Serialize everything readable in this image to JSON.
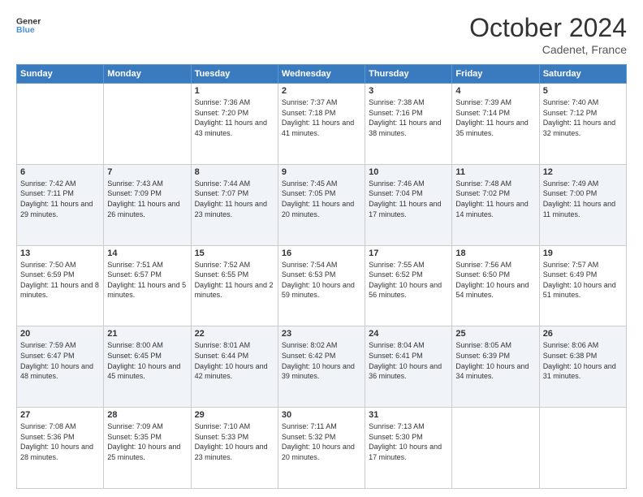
{
  "header": {
    "logo_line1": "General",
    "logo_line2": "Blue",
    "month": "October 2024",
    "location": "Cadenet, France"
  },
  "weekdays": [
    "Sunday",
    "Monday",
    "Tuesday",
    "Wednesday",
    "Thursday",
    "Friday",
    "Saturday"
  ],
  "weeks": [
    [
      {
        "day": "",
        "sunrise": "",
        "sunset": "",
        "daylight": ""
      },
      {
        "day": "",
        "sunrise": "",
        "sunset": "",
        "daylight": ""
      },
      {
        "day": "1",
        "sunrise": "Sunrise: 7:36 AM",
        "sunset": "Sunset: 7:20 PM",
        "daylight": "Daylight: 11 hours and 43 minutes."
      },
      {
        "day": "2",
        "sunrise": "Sunrise: 7:37 AM",
        "sunset": "Sunset: 7:18 PM",
        "daylight": "Daylight: 11 hours and 41 minutes."
      },
      {
        "day": "3",
        "sunrise": "Sunrise: 7:38 AM",
        "sunset": "Sunset: 7:16 PM",
        "daylight": "Daylight: 11 hours and 38 minutes."
      },
      {
        "day": "4",
        "sunrise": "Sunrise: 7:39 AM",
        "sunset": "Sunset: 7:14 PM",
        "daylight": "Daylight: 11 hours and 35 minutes."
      },
      {
        "day": "5",
        "sunrise": "Sunrise: 7:40 AM",
        "sunset": "Sunset: 7:12 PM",
        "daylight": "Daylight: 11 hours and 32 minutes."
      }
    ],
    [
      {
        "day": "6",
        "sunrise": "Sunrise: 7:42 AM",
        "sunset": "Sunset: 7:11 PM",
        "daylight": "Daylight: 11 hours and 29 minutes."
      },
      {
        "day": "7",
        "sunrise": "Sunrise: 7:43 AM",
        "sunset": "Sunset: 7:09 PM",
        "daylight": "Daylight: 11 hours and 26 minutes."
      },
      {
        "day": "8",
        "sunrise": "Sunrise: 7:44 AM",
        "sunset": "Sunset: 7:07 PM",
        "daylight": "Daylight: 11 hours and 23 minutes."
      },
      {
        "day": "9",
        "sunrise": "Sunrise: 7:45 AM",
        "sunset": "Sunset: 7:05 PM",
        "daylight": "Daylight: 11 hours and 20 minutes."
      },
      {
        "day": "10",
        "sunrise": "Sunrise: 7:46 AM",
        "sunset": "Sunset: 7:04 PM",
        "daylight": "Daylight: 11 hours and 17 minutes."
      },
      {
        "day": "11",
        "sunrise": "Sunrise: 7:48 AM",
        "sunset": "Sunset: 7:02 PM",
        "daylight": "Daylight: 11 hours and 14 minutes."
      },
      {
        "day": "12",
        "sunrise": "Sunrise: 7:49 AM",
        "sunset": "Sunset: 7:00 PM",
        "daylight": "Daylight: 11 hours and 11 minutes."
      }
    ],
    [
      {
        "day": "13",
        "sunrise": "Sunrise: 7:50 AM",
        "sunset": "Sunset: 6:59 PM",
        "daylight": "Daylight: 11 hours and 8 minutes."
      },
      {
        "day": "14",
        "sunrise": "Sunrise: 7:51 AM",
        "sunset": "Sunset: 6:57 PM",
        "daylight": "Daylight: 11 hours and 5 minutes."
      },
      {
        "day": "15",
        "sunrise": "Sunrise: 7:52 AM",
        "sunset": "Sunset: 6:55 PM",
        "daylight": "Daylight: 11 hours and 2 minutes."
      },
      {
        "day": "16",
        "sunrise": "Sunrise: 7:54 AM",
        "sunset": "Sunset: 6:53 PM",
        "daylight": "Daylight: 10 hours and 59 minutes."
      },
      {
        "day": "17",
        "sunrise": "Sunrise: 7:55 AM",
        "sunset": "Sunset: 6:52 PM",
        "daylight": "Daylight: 10 hours and 56 minutes."
      },
      {
        "day": "18",
        "sunrise": "Sunrise: 7:56 AM",
        "sunset": "Sunset: 6:50 PM",
        "daylight": "Daylight: 10 hours and 54 minutes."
      },
      {
        "day": "19",
        "sunrise": "Sunrise: 7:57 AM",
        "sunset": "Sunset: 6:49 PM",
        "daylight": "Daylight: 10 hours and 51 minutes."
      }
    ],
    [
      {
        "day": "20",
        "sunrise": "Sunrise: 7:59 AM",
        "sunset": "Sunset: 6:47 PM",
        "daylight": "Daylight: 10 hours and 48 minutes."
      },
      {
        "day": "21",
        "sunrise": "Sunrise: 8:00 AM",
        "sunset": "Sunset: 6:45 PM",
        "daylight": "Daylight: 10 hours and 45 minutes."
      },
      {
        "day": "22",
        "sunrise": "Sunrise: 8:01 AM",
        "sunset": "Sunset: 6:44 PM",
        "daylight": "Daylight: 10 hours and 42 minutes."
      },
      {
        "day": "23",
        "sunrise": "Sunrise: 8:02 AM",
        "sunset": "Sunset: 6:42 PM",
        "daylight": "Daylight: 10 hours and 39 minutes."
      },
      {
        "day": "24",
        "sunrise": "Sunrise: 8:04 AM",
        "sunset": "Sunset: 6:41 PM",
        "daylight": "Daylight: 10 hours and 36 minutes."
      },
      {
        "day": "25",
        "sunrise": "Sunrise: 8:05 AM",
        "sunset": "Sunset: 6:39 PM",
        "daylight": "Daylight: 10 hours and 34 minutes."
      },
      {
        "day": "26",
        "sunrise": "Sunrise: 8:06 AM",
        "sunset": "Sunset: 6:38 PM",
        "daylight": "Daylight: 10 hours and 31 minutes."
      }
    ],
    [
      {
        "day": "27",
        "sunrise": "Sunrise: 7:08 AM",
        "sunset": "Sunset: 5:36 PM",
        "daylight": "Daylight: 10 hours and 28 minutes."
      },
      {
        "day": "28",
        "sunrise": "Sunrise: 7:09 AM",
        "sunset": "Sunset: 5:35 PM",
        "daylight": "Daylight: 10 hours and 25 minutes."
      },
      {
        "day": "29",
        "sunrise": "Sunrise: 7:10 AM",
        "sunset": "Sunset: 5:33 PM",
        "daylight": "Daylight: 10 hours and 23 minutes."
      },
      {
        "day": "30",
        "sunrise": "Sunrise: 7:11 AM",
        "sunset": "Sunset: 5:32 PM",
        "daylight": "Daylight: 10 hours and 20 minutes."
      },
      {
        "day": "31",
        "sunrise": "Sunrise: 7:13 AM",
        "sunset": "Sunset: 5:30 PM",
        "daylight": "Daylight: 10 hours and 17 minutes."
      },
      {
        "day": "",
        "sunrise": "",
        "sunset": "",
        "daylight": ""
      },
      {
        "day": "",
        "sunrise": "",
        "sunset": "",
        "daylight": ""
      }
    ]
  ]
}
